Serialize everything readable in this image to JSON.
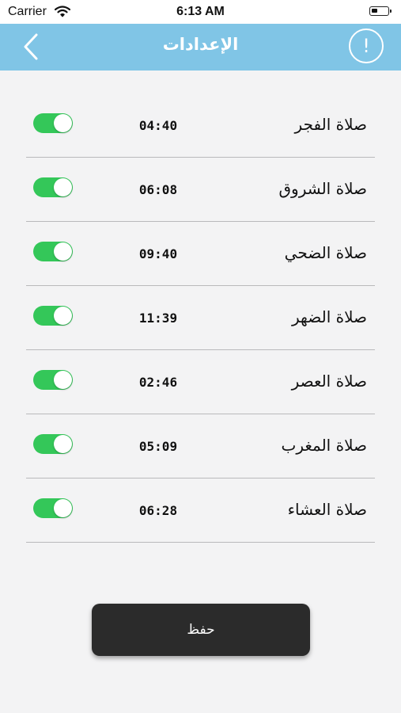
{
  "status_bar": {
    "carrier": "Carrier",
    "time": "6:13 AM"
  },
  "nav": {
    "title": "الإعدادات",
    "info_label": "!"
  },
  "prayers": [
    {
      "name": "صلاة الفجر",
      "time": "04:40",
      "enabled": true
    },
    {
      "name": "صلاة الشروق",
      "time": "06:08",
      "enabled": true
    },
    {
      "name": "صلاة الضحي",
      "time": "09:40",
      "enabled": true
    },
    {
      "name": "صلاة الضهر",
      "time": "11:39",
      "enabled": true
    },
    {
      "name": "صلاة العصر",
      "time": "02:46",
      "enabled": true
    },
    {
      "name": "صلاة المغرب",
      "time": "05:09",
      "enabled": true
    },
    {
      "name": "صلاة العشاء",
      "time": "06:28",
      "enabled": true
    }
  ],
  "save_label": "حفظ",
  "colors": {
    "nav_bar": "#80c5e6",
    "toggle_on": "#34c759",
    "save_button": "#2b2b2b",
    "background": "#f3f3f4"
  }
}
